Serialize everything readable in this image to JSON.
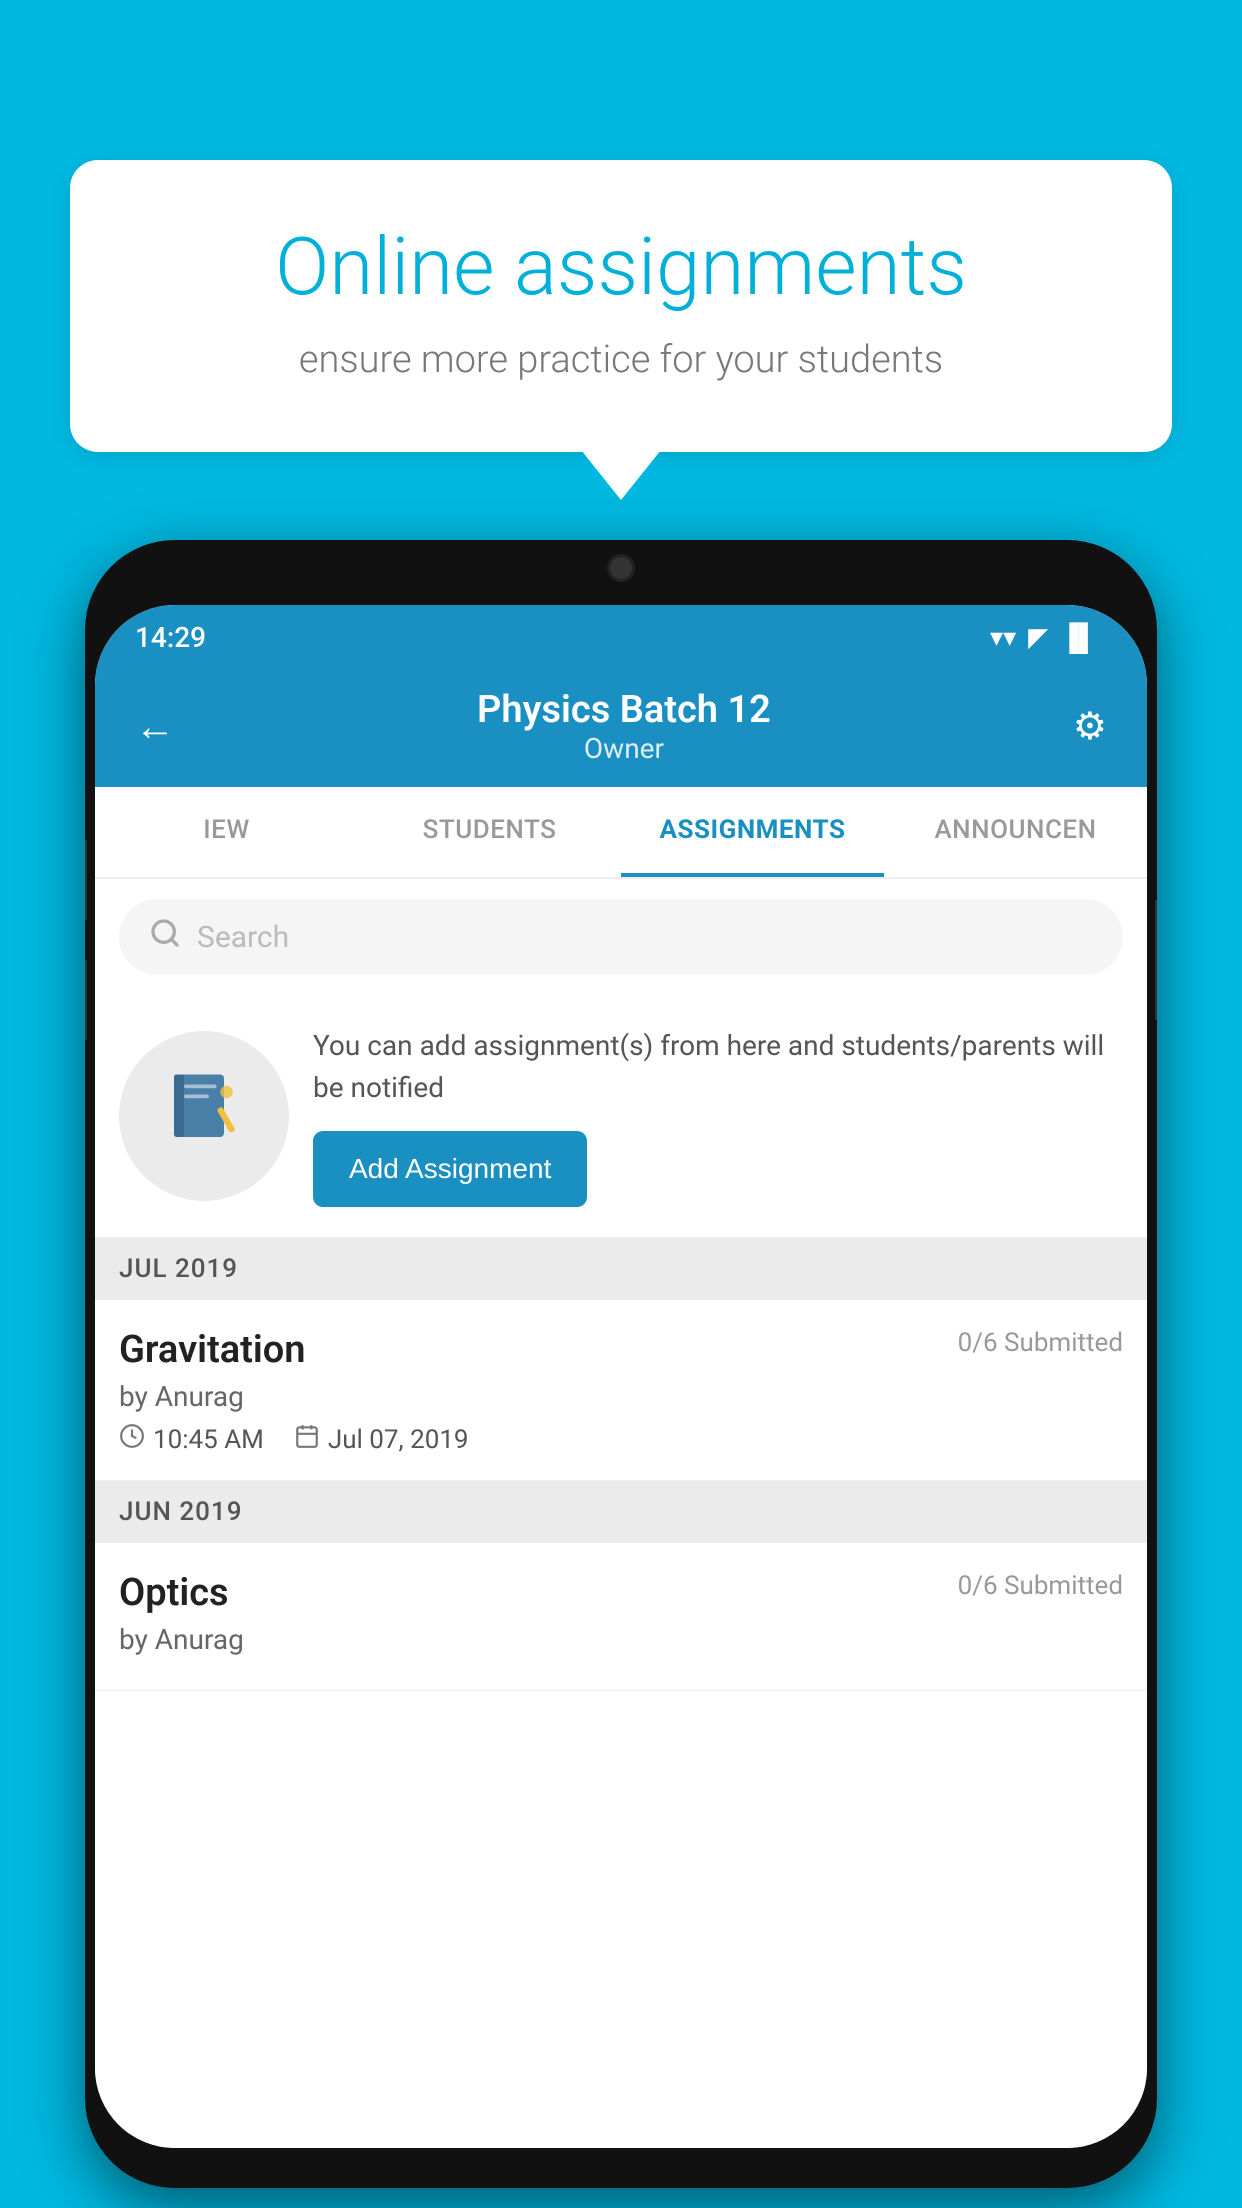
{
  "background": {
    "color": "#00b8e0"
  },
  "speech_bubble": {
    "title": "Online assignments",
    "subtitle": "ensure more practice for your students"
  },
  "phone": {
    "status_bar": {
      "time": "14:29",
      "wifi": "▼",
      "signal": "▲",
      "battery": "▐"
    },
    "header": {
      "title": "Physics Batch 12",
      "subtitle": "Owner",
      "back_label": "←",
      "settings_label": "⚙"
    },
    "tabs": [
      {
        "label": "IEW",
        "active": false
      },
      {
        "label": "STUDENTS",
        "active": false
      },
      {
        "label": "ASSIGNMENTS",
        "active": true
      },
      {
        "label": "ANNOUNCEMENTS",
        "active": false
      }
    ],
    "search": {
      "placeholder": "Search"
    },
    "info_section": {
      "text": "You can add assignment(s) from here and students/parents will be notified",
      "button_label": "Add Assignment"
    },
    "assignments": [
      {
        "month_header": "JUL 2019",
        "name": "Gravitation",
        "submitted": "0/6 Submitted",
        "author": "by Anurag",
        "time": "10:45 AM",
        "date": "Jul 07, 2019"
      },
      {
        "month_header": "JUN 2019",
        "name": "Optics",
        "submitted": "0/6 Submitted",
        "author": "by Anurag",
        "time": "",
        "date": ""
      }
    ]
  }
}
